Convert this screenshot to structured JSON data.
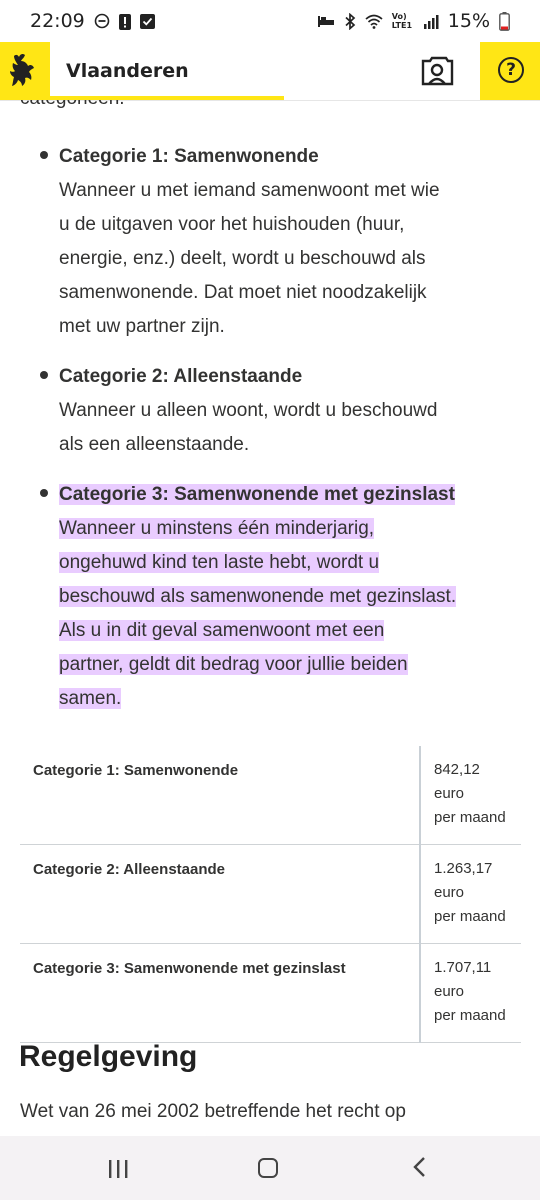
{
  "status_bar": {
    "time": "22:09",
    "battery_percent": "15%",
    "network_label": "Vo) LTE1"
  },
  "header": {
    "brand": "Vlaanderen",
    "help_symbol": "?"
  },
  "content": {
    "cut_text": "categorieën.",
    "categories": [
      {
        "title": "Categorie 1: Samenwonende",
        "lines": [
          "Wanneer u met iemand samenwoont met wie",
          "u de uitgaven voor het huishouden (huur,",
          "energie, enz.) deelt, wordt u beschouwd als",
          "samenwonende. Dat moet niet noodzakelijk",
          "met uw partner zijn."
        ]
      },
      {
        "title": "Categorie 2: Alleenstaande",
        "lines": [
          "Wanneer u alleen woont, wordt u beschouwd",
          "als een alleenstaande."
        ]
      },
      {
        "title": "Categorie 3: Samenwonende met gezinslast",
        "lines": [
          "Wanneer u minstens één minderjarig,",
          "ongehuwd kind ten laste hebt, wordt u",
          "beschouwd als samenwonende met gezinslast.",
          "Als u in dit geval samenwoont met een",
          "partner, geldt dit bedrag voor jullie beiden",
          "samen."
        ]
      }
    ],
    "table": [
      {
        "category": "Categorie 1: Samenwonende",
        "amount": "842,12 euro",
        "period": "per maand"
      },
      {
        "category": "Categorie 2: Alleenstaande",
        "amount": "1.263,17 euro",
        "period": "per maand"
      },
      {
        "category": "Categorie 3: Samenwonende met gezinslast",
        "amount": "1.707,11 euro",
        "period": "per maand"
      }
    ],
    "heading": "Regelgeving",
    "paragraph": "Wet van 26 mei 2002 betreffende het recht op"
  },
  "colors": {
    "brand_yellow": "#ffe615",
    "highlight": "#e9ccff",
    "text": "#333332"
  }
}
